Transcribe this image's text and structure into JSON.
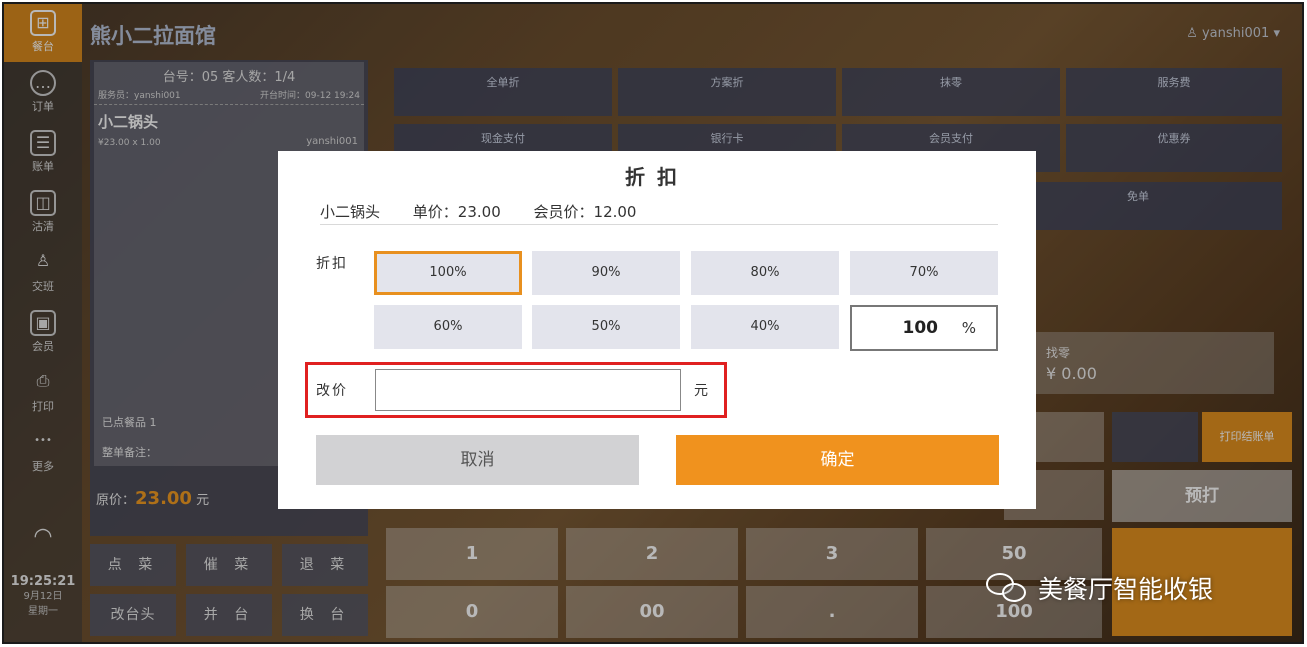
{
  "header": {
    "restaurant_name": "熊小二拉面馆",
    "user": "yanshi001"
  },
  "sidebar": {
    "items": [
      {
        "label": "餐台",
        "icon": "table-plus-icon",
        "glyph": "⊞"
      },
      {
        "label": "订单",
        "icon": "order-chat-icon",
        "glyph": "…"
      },
      {
        "label": "账单",
        "icon": "bill-icon",
        "glyph": "☰"
      },
      {
        "label": "沽清",
        "icon": "sold-out-icon",
        "glyph": "◫"
      },
      {
        "label": "交班",
        "icon": "shift-handover-icon",
        "glyph": "♙"
      },
      {
        "label": "会员",
        "icon": "member-card-icon",
        "glyph": "▣"
      },
      {
        "label": "打印",
        "icon": "printer-icon",
        "glyph": "⎙"
      },
      {
        "label": "更多",
        "icon": "more-dots-icon",
        "glyph": "•••"
      }
    ],
    "time": "19:25:21",
    "date": "9月12日",
    "weekday": "星期一"
  },
  "order": {
    "table_line": "台号：05  客人数：1/4",
    "waiter": "服务员：yanshi001",
    "open_time": "开台时间：09-12 19:24",
    "dish_name": "小二锅头",
    "dish_user": "yanshi001",
    "dish_price": "¥23.00  x 1.00",
    "ordered_count": "已点餐品  1",
    "order_note": "整单备注：",
    "original_price_label": "原价：",
    "original_price_value": "23.00",
    "original_price_unit": "元"
  },
  "order_actions": [
    "点 菜",
    "催 菜",
    "退 菜",
    "改台头",
    "并 台",
    "换 台"
  ],
  "payment": {
    "row1": [
      "全单折",
      "方案折",
      "抹零",
      "服务费"
    ],
    "row2": [
      "现金支付",
      "银行卡",
      "会员支付",
      "优惠券"
    ],
    "free": "免单",
    "change_label": "找零",
    "change_value": "¥ 0.00",
    "print_bill": "打印结账单",
    "prepay": "预打",
    "keys": [
      "1",
      "2",
      "3",
      "50",
      "0",
      "00",
      ".",
      "100"
    ]
  },
  "modal": {
    "title": "折扣",
    "item_name": "小二锅头",
    "unit_price": "单价：23.00",
    "member_price": "会员价：12.00",
    "discount_label": "折扣",
    "discounts": [
      "100%",
      "90%",
      "80%",
      "70%",
      "60%",
      "50%",
      "40%"
    ],
    "selected_discount": "100%",
    "custom_discount_value": "100",
    "custom_discount_unit": "%",
    "price_label": "改价",
    "price_value": "",
    "price_unit": "元",
    "cancel": "取消",
    "confirm": "确定"
  },
  "watermark": "美餐厅智能收银",
  "colors": {
    "accent_orange": "#f0921e",
    "highlight_red": "#e02020",
    "selected_border": "#e8901f"
  }
}
